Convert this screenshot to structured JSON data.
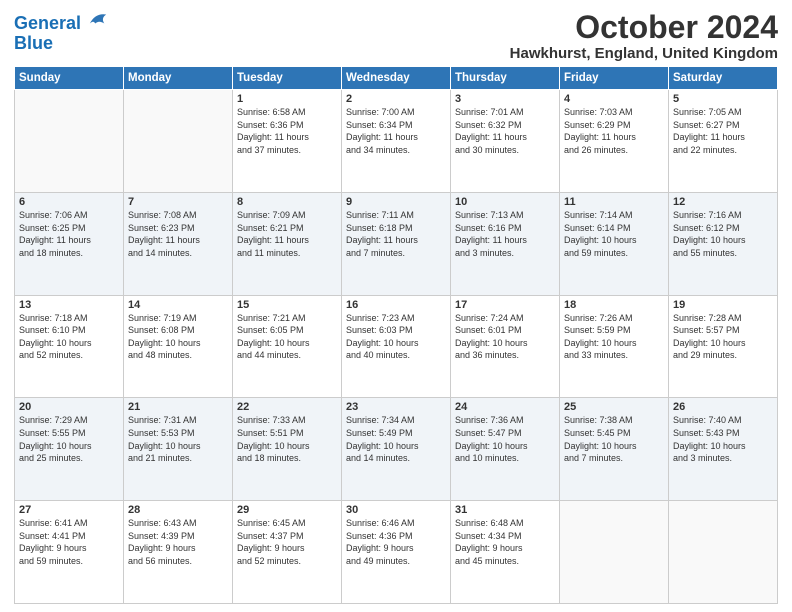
{
  "logo": {
    "line1": "General",
    "line2": "Blue"
  },
  "title": "October 2024",
  "subtitle": "Hawkhurst, England, United Kingdom",
  "headers": [
    "Sunday",
    "Monday",
    "Tuesday",
    "Wednesday",
    "Thursday",
    "Friday",
    "Saturday"
  ],
  "weeks": [
    [
      {
        "day": "",
        "info": ""
      },
      {
        "day": "",
        "info": ""
      },
      {
        "day": "1",
        "info": "Sunrise: 6:58 AM\nSunset: 6:36 PM\nDaylight: 11 hours\nand 37 minutes."
      },
      {
        "day": "2",
        "info": "Sunrise: 7:00 AM\nSunset: 6:34 PM\nDaylight: 11 hours\nand 34 minutes."
      },
      {
        "day": "3",
        "info": "Sunrise: 7:01 AM\nSunset: 6:32 PM\nDaylight: 11 hours\nand 30 minutes."
      },
      {
        "day": "4",
        "info": "Sunrise: 7:03 AM\nSunset: 6:29 PM\nDaylight: 11 hours\nand 26 minutes."
      },
      {
        "day": "5",
        "info": "Sunrise: 7:05 AM\nSunset: 6:27 PM\nDaylight: 11 hours\nand 22 minutes."
      }
    ],
    [
      {
        "day": "6",
        "info": "Sunrise: 7:06 AM\nSunset: 6:25 PM\nDaylight: 11 hours\nand 18 minutes."
      },
      {
        "day": "7",
        "info": "Sunrise: 7:08 AM\nSunset: 6:23 PM\nDaylight: 11 hours\nand 14 minutes."
      },
      {
        "day": "8",
        "info": "Sunrise: 7:09 AM\nSunset: 6:21 PM\nDaylight: 11 hours\nand 11 minutes."
      },
      {
        "day": "9",
        "info": "Sunrise: 7:11 AM\nSunset: 6:18 PM\nDaylight: 11 hours\nand 7 minutes."
      },
      {
        "day": "10",
        "info": "Sunrise: 7:13 AM\nSunset: 6:16 PM\nDaylight: 11 hours\nand 3 minutes."
      },
      {
        "day": "11",
        "info": "Sunrise: 7:14 AM\nSunset: 6:14 PM\nDaylight: 10 hours\nand 59 minutes."
      },
      {
        "day": "12",
        "info": "Sunrise: 7:16 AM\nSunset: 6:12 PM\nDaylight: 10 hours\nand 55 minutes."
      }
    ],
    [
      {
        "day": "13",
        "info": "Sunrise: 7:18 AM\nSunset: 6:10 PM\nDaylight: 10 hours\nand 52 minutes."
      },
      {
        "day": "14",
        "info": "Sunrise: 7:19 AM\nSunset: 6:08 PM\nDaylight: 10 hours\nand 48 minutes."
      },
      {
        "day": "15",
        "info": "Sunrise: 7:21 AM\nSunset: 6:05 PM\nDaylight: 10 hours\nand 44 minutes."
      },
      {
        "day": "16",
        "info": "Sunrise: 7:23 AM\nSunset: 6:03 PM\nDaylight: 10 hours\nand 40 minutes."
      },
      {
        "day": "17",
        "info": "Sunrise: 7:24 AM\nSunset: 6:01 PM\nDaylight: 10 hours\nand 36 minutes."
      },
      {
        "day": "18",
        "info": "Sunrise: 7:26 AM\nSunset: 5:59 PM\nDaylight: 10 hours\nand 33 minutes."
      },
      {
        "day": "19",
        "info": "Sunrise: 7:28 AM\nSunset: 5:57 PM\nDaylight: 10 hours\nand 29 minutes."
      }
    ],
    [
      {
        "day": "20",
        "info": "Sunrise: 7:29 AM\nSunset: 5:55 PM\nDaylight: 10 hours\nand 25 minutes."
      },
      {
        "day": "21",
        "info": "Sunrise: 7:31 AM\nSunset: 5:53 PM\nDaylight: 10 hours\nand 21 minutes."
      },
      {
        "day": "22",
        "info": "Sunrise: 7:33 AM\nSunset: 5:51 PM\nDaylight: 10 hours\nand 18 minutes."
      },
      {
        "day": "23",
        "info": "Sunrise: 7:34 AM\nSunset: 5:49 PM\nDaylight: 10 hours\nand 14 minutes."
      },
      {
        "day": "24",
        "info": "Sunrise: 7:36 AM\nSunset: 5:47 PM\nDaylight: 10 hours\nand 10 minutes."
      },
      {
        "day": "25",
        "info": "Sunrise: 7:38 AM\nSunset: 5:45 PM\nDaylight: 10 hours\nand 7 minutes."
      },
      {
        "day": "26",
        "info": "Sunrise: 7:40 AM\nSunset: 5:43 PM\nDaylight: 10 hours\nand 3 minutes."
      }
    ],
    [
      {
        "day": "27",
        "info": "Sunrise: 6:41 AM\nSunset: 4:41 PM\nDaylight: 9 hours\nand 59 minutes."
      },
      {
        "day": "28",
        "info": "Sunrise: 6:43 AM\nSunset: 4:39 PM\nDaylight: 9 hours\nand 56 minutes."
      },
      {
        "day": "29",
        "info": "Sunrise: 6:45 AM\nSunset: 4:37 PM\nDaylight: 9 hours\nand 52 minutes."
      },
      {
        "day": "30",
        "info": "Sunrise: 6:46 AM\nSunset: 4:36 PM\nDaylight: 9 hours\nand 49 minutes."
      },
      {
        "day": "31",
        "info": "Sunrise: 6:48 AM\nSunset: 4:34 PM\nDaylight: 9 hours\nand 45 minutes."
      },
      {
        "day": "",
        "info": ""
      },
      {
        "day": "",
        "info": ""
      }
    ]
  ]
}
